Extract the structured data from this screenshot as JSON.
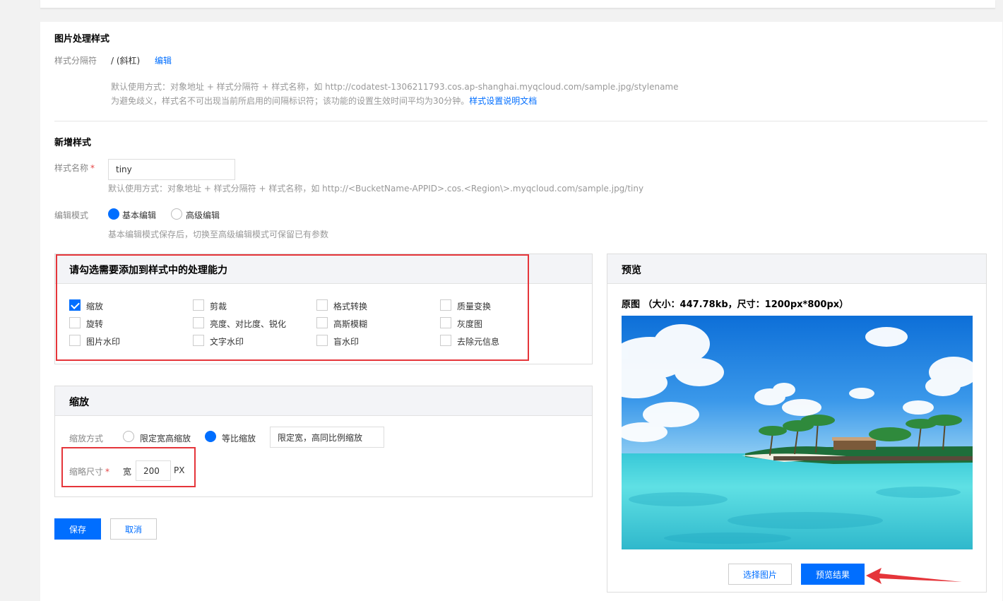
{
  "style_settings": {
    "title": "图片处理样式",
    "separator_label": "样式分隔符",
    "separator_value": "/ (斜杠)",
    "edit_link": "编辑",
    "hint_line1": "默认使用方式：对象地址 + 样式分隔符 + 样式名称，如 http://codatest-1306211793.cos.ap-shanghai.myqcloud.com/sample.jpg/stylename",
    "hint_line2": "为避免歧义，样式名不可出现当前所启用的间隔标识符；该功能的设置生效时间平均为30分钟。",
    "doc_link": "样式设置说明文档"
  },
  "new_style": {
    "title": "新增样式",
    "name_label": "样式名称",
    "required_mark": "*",
    "name_value": "tiny",
    "name_hint": "默认使用方式：对象地址 + 样式分隔符 + 样式名称，如 http://<BucketName-APPID>.cos.<Region\\>.myqcloud.com/sample.jpg/tiny",
    "mode_label": "编辑模式",
    "mode_basic": "基本编辑",
    "mode_advanced": "高级编辑",
    "mode_selected": "basic",
    "mode_hint": "基本编辑模式保存后，切换至高级编辑模式可保留已有参数"
  },
  "capabilities": {
    "title": "请勾选需要添加到样式中的处理能力",
    "items": [
      {
        "label": "缩放",
        "checked": true
      },
      {
        "label": "剪裁",
        "checked": false
      },
      {
        "label": "格式转换",
        "checked": false
      },
      {
        "label": "质量变换",
        "checked": false
      },
      {
        "label": "旋转",
        "checked": false
      },
      {
        "label": "亮度、对比度、锐化",
        "checked": false
      },
      {
        "label": "高斯模糊",
        "checked": false
      },
      {
        "label": "灰度图",
        "checked": false
      },
      {
        "label": "图片水印",
        "checked": false
      },
      {
        "label": "文字水印",
        "checked": false
      },
      {
        "label": "盲水印",
        "checked": false
      },
      {
        "label": "去除元信息",
        "checked": false
      }
    ]
  },
  "scale": {
    "title": "缩放",
    "method_label": "缩放方式",
    "method_fixed": "限定宽高缩放",
    "method_proportional": "等比缩放",
    "method_selected": "proportional",
    "sub_option": "限定宽，高同比例缩放",
    "size_label": "缩略尺寸",
    "required_mark": "*",
    "width_label": "宽",
    "width_value": "200",
    "unit": "PX"
  },
  "actions": {
    "save": "保存",
    "cancel": "取消"
  },
  "preview": {
    "title": "预览",
    "original_info": "原图 （大小：447.78kb，尺寸：1200px*800px）",
    "image_desc": "tropical-beach-photo",
    "select_image": "选择图片",
    "preview_result": "预览结果"
  },
  "colors": {
    "primary": "#006eff",
    "annotation_red": "#e5353a"
  }
}
